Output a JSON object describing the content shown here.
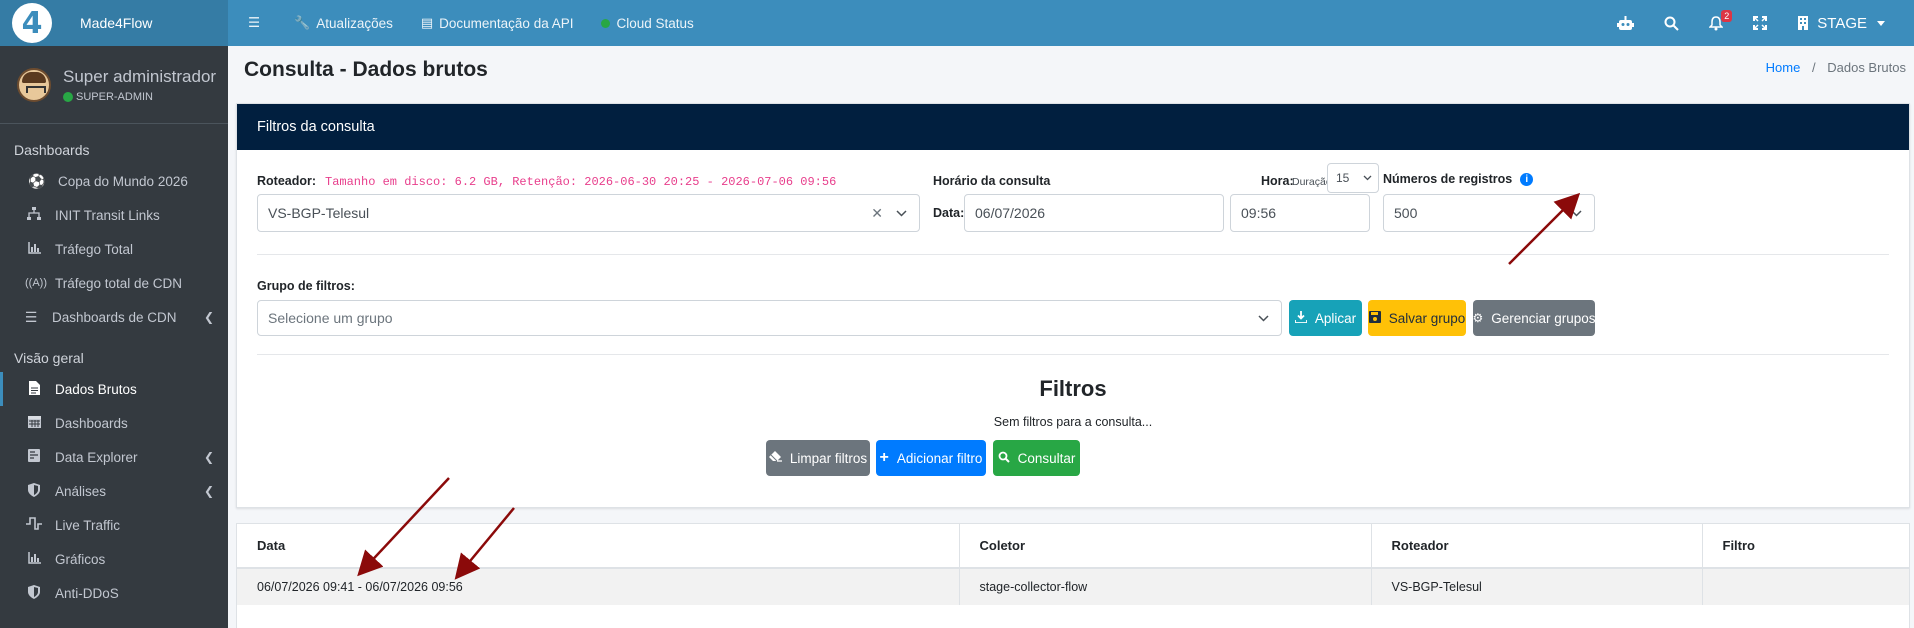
{
  "topbar": {
    "brand_logo": "4",
    "brand_name": "Made4Flow",
    "nav": [
      {
        "label": "Atualizações"
      },
      {
        "label": "Documentação da API"
      },
      {
        "label": "Cloud Status"
      }
    ],
    "notification_count": "2",
    "environment": "STAGE"
  },
  "sidebar": {
    "user_name": "Super administrador",
    "user_role": "SUPER-ADMIN",
    "sections": [
      {
        "header": "Dashboards",
        "items": [
          {
            "label": "Copa do Mundo 2026",
            "icon": "soccer-ball-icon"
          },
          {
            "label": "INIT Transit Links",
            "icon": "sitemap-icon"
          },
          {
            "label": "Tráfego Total",
            "icon": "chart-icon"
          },
          {
            "label": "Tráfego total de CDN",
            "icon": "broadcast-icon"
          },
          {
            "label": "Dashboards de CDN",
            "icon": "list-icon"
          }
        ]
      },
      {
        "header": "Visão geral",
        "items": [
          {
            "label": "Dados Brutos",
            "icon": "file-icon"
          },
          {
            "label": "Dashboards",
            "icon": "calendar-icon"
          },
          {
            "label": "Data Explorer",
            "icon": "explorer-icon"
          },
          {
            "label": "Análises",
            "icon": "shield-icon"
          },
          {
            "label": "Live Traffic",
            "icon": "wave-icon"
          },
          {
            "label": "Gráficos",
            "icon": "chart-icon"
          },
          {
            "label": "Anti-DDoS",
            "icon": "shield-icon"
          }
        ]
      }
    ]
  },
  "page": {
    "title": "Consulta - Dados brutos",
    "breadcrumb_home": "Home",
    "breadcrumb_current": "Dados Brutos"
  },
  "filters_card": {
    "header": "Filtros da consulta",
    "router_label": "Roteador:",
    "router_info": "Tamanho em disco: 6.2 GB, Retenção: 2026-06-30 20:25 - 2026-07-06 09:56",
    "router_value": "VS-BGP-Telesul",
    "time_label": "Horário da consulta",
    "hour_label": "Hora:",
    "duration_label": "Duração",
    "duration_value": "15",
    "date_label": "Data:",
    "date_value": "06/07/2026",
    "hour_value": "09:56",
    "records_label": "Números de registros",
    "records_value": "500",
    "group_label": "Grupo de filtros:",
    "group_placeholder": "Selecione um grupo",
    "apply_btn": "Aplicar",
    "save_group_btn": "Salvar grupo",
    "manage_groups_btn": "Gerenciar grupos",
    "filters_title": "Filtros",
    "filters_empty": "Sem filtros para a consulta...",
    "clear_btn": "Limpar filtros",
    "add_filter_btn": "Adicionar filtro",
    "query_btn": "Consultar"
  },
  "results_table": {
    "headers": [
      "Data",
      "Coletor",
      "Roteador",
      "Filtro"
    ],
    "rows": [
      [
        "06/07/2026 09:41 - 06/07/2026 09:56",
        "stage-collector-flow",
        "VS-BGP-Telesul",
        ""
      ]
    ]
  },
  "colors": {
    "topbar": "#3c8dbc",
    "sidebar": "#343a40",
    "card_header": "#011f3f",
    "annotation_arrow": "#8b0a0a"
  }
}
